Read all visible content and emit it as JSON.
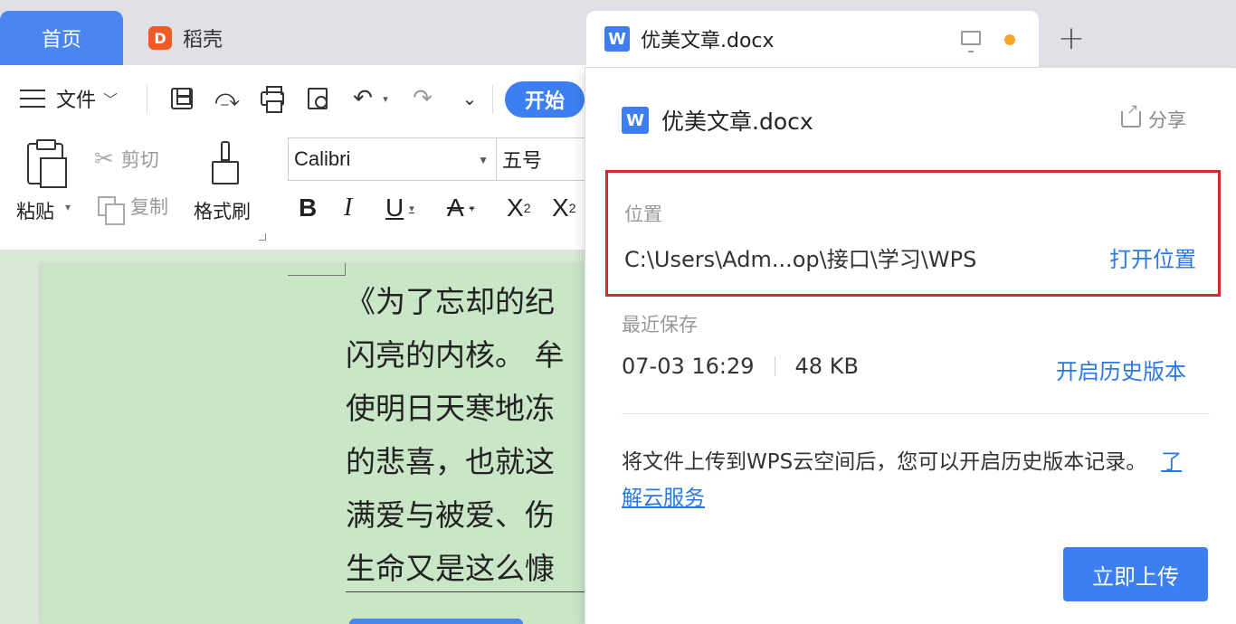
{
  "tabs": {
    "home": "首页",
    "daoke": "稻壳",
    "daoke_logo": "D",
    "doc": "优美文章.docx",
    "doc_icon": "W",
    "new_tab": "+"
  },
  "toolbar": {
    "file_menu": "文件",
    "start_button": "开始",
    "undo_glyph": "↶",
    "redo_glyph": "↷",
    "customize_glyph": "⌄",
    "paste": "粘贴",
    "cut": "剪切",
    "copy": "复制",
    "format_painter": "格式刷",
    "font_name": "Calibri",
    "font_size": "五号",
    "bold": "B",
    "italic": "I",
    "underline": "U",
    "strikethrough": "A",
    "superscript_base": "X",
    "superscript_exp": "2",
    "subscript_base": "X",
    "subscript_exp": "2"
  },
  "document": {
    "lines": [
      "《为了忘却的纪",
      "闪亮的内核。 牟",
      "使明日天寒地冻",
      "的悲喜，也就这",
      "满爱与被爱、伤",
      "生命又是这么慷"
    ]
  },
  "panel": {
    "file_name": "优美文章.docx",
    "file_icon": "W",
    "share": "分享",
    "location_label": "位置",
    "location_path": "C:\\Users\\Adm...op\\接口\\学习\\WPS",
    "open_location": "打开位置",
    "recent_save_label": "最近保存",
    "saved_time": "07-03 16:29",
    "file_size": "48 KB",
    "history_link": "开启历史版本",
    "upload_hint": "将文件上传到WPS云空间后，您可以开启历史版本记录。",
    "cloud_link": "了解云服务",
    "upload_button": "立即上传"
  },
  "colors": {
    "accent": "#3d7ff1",
    "link": "#2b78e4",
    "highlight_border": "#d42a2a",
    "unsaved_dot": "#f5a623",
    "document_background": "#c9e6c6"
  },
  "icons": [
    "daoke-logo-icon",
    "wps-writer-icon",
    "screen-icon",
    "hamburger-icon",
    "save-icon",
    "save-as-icon",
    "print-icon",
    "print-preview-icon",
    "undo-icon",
    "redo-icon",
    "paste-icon",
    "scissors-icon",
    "copy-icon",
    "brush-icon",
    "share-icon"
  ]
}
